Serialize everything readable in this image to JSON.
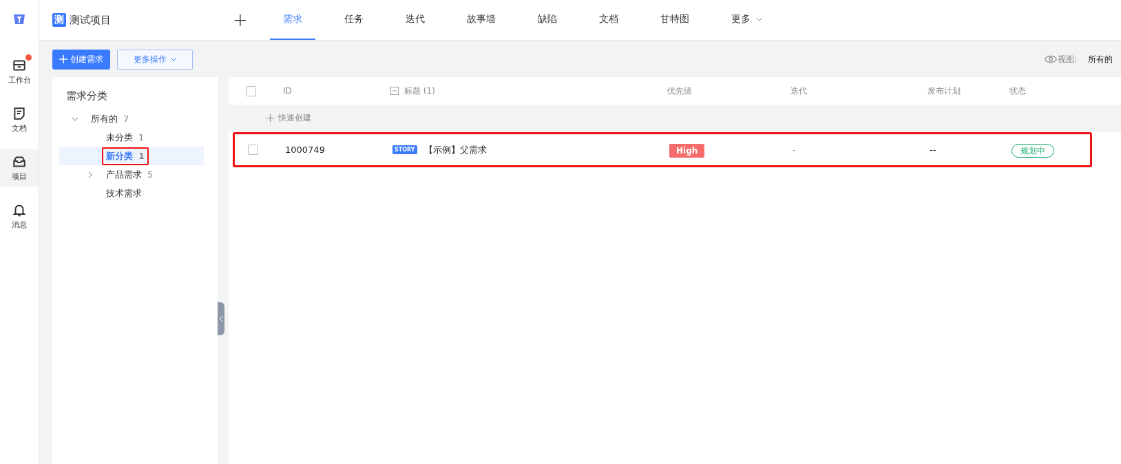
{
  "rail": [
    {
      "label": "工作台",
      "badge": true,
      "selected": false,
      "kind": "inbox"
    },
    {
      "label": "文档",
      "badge": false,
      "selected": false,
      "kind": "doc"
    },
    {
      "label": "项目",
      "badge": false,
      "selected": true,
      "kind": "box"
    },
    {
      "label": "消息",
      "badge": false,
      "selected": false,
      "kind": "bell"
    }
  ],
  "project": {
    "logo": "测",
    "name": "测试项目"
  },
  "add_button": "+",
  "tabs": [
    {
      "label": "需求",
      "selected": true
    },
    {
      "label": "任务",
      "selected": false
    },
    {
      "label": "迭代",
      "selected": false
    },
    {
      "label": "故事墙",
      "selected": false
    },
    {
      "label": "缺陷",
      "selected": false
    },
    {
      "label": "文档",
      "selected": false
    },
    {
      "label": "甘特图",
      "selected": false
    },
    {
      "label": "更多",
      "selected": false,
      "dropdown": true
    }
  ],
  "toolbar": {
    "create_button": "创建需求",
    "more_button": "更多操作",
    "view_label": "视图:",
    "view_value": "所有的"
  },
  "tree": {
    "title": "需求分类",
    "items": [
      {
        "label": "所有的",
        "count": "7",
        "expanded": true,
        "selected": false,
        "highlighted": false,
        "children": [
          {
            "label": "未分类",
            "count": "1",
            "selected": false,
            "highlighted": false
          },
          {
            "label": "新分类",
            "count": "1",
            "selected": true,
            "highlighted": true
          },
          {
            "label": "产品需求",
            "count": "5",
            "expanded": false,
            "selected": false,
            "highlighted": false
          },
          {
            "label": "技术需求",
            "selected": false,
            "highlighted": false
          }
        ]
      }
    ]
  },
  "table": {
    "columns": [
      "ID",
      "标题",
      "优先级",
      "迭代",
      "发布计划",
      "状态"
    ],
    "title_count": "(1)",
    "select_all_checked": false,
    "quick_create": "快速创建",
    "rows": [
      {
        "checked": false,
        "highlighted": true,
        "id": "1000749",
        "type": "STORY",
        "title": "【示例】父需求",
        "priority": {
          "label": "High",
          "color": "#f56c6c"
        },
        "iteration": "-",
        "release": "--",
        "status": {
          "label": "规划中",
          "color": "#1aad6c"
        }
      }
    ]
  }
}
